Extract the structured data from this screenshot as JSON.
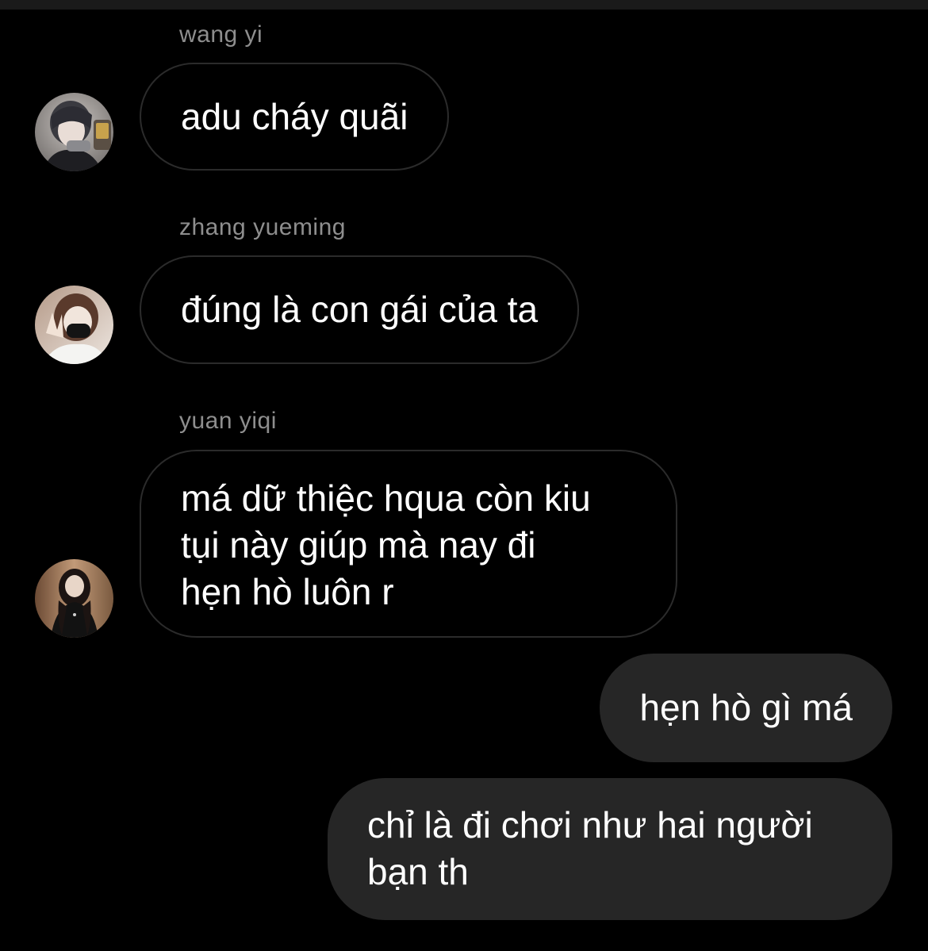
{
  "conversation": {
    "messages": [
      {
        "sender": "wang yi",
        "avatar": "avatar-photo",
        "text": "adu cháy quãi",
        "direction": "incoming"
      },
      {
        "sender": "zhang yueming",
        "avatar": "avatar-photo",
        "text": "đúng là con gái của ta",
        "direction": "incoming"
      },
      {
        "sender": "yuan yiqi",
        "avatar": "avatar-photo",
        "text_lines": [
          "má dữ thiệc hqua còn kiu",
          "tụi này giúp mà nay đi",
          "hẹn hò luôn r"
        ],
        "direction": "incoming"
      },
      {
        "text": "hẹn hò gì má",
        "direction": "outgoing"
      },
      {
        "text_lines": [
          "chỉ là đi chơi như hai người",
          "bạn th"
        ],
        "direction": "outgoing"
      }
    ]
  },
  "colors": {
    "background": "#000000",
    "incoming_bubble_border": "#2b2b2b",
    "outgoing_bubble": "#262626",
    "sender_name": "#8e8e8e",
    "message_text": "#ffffff"
  }
}
